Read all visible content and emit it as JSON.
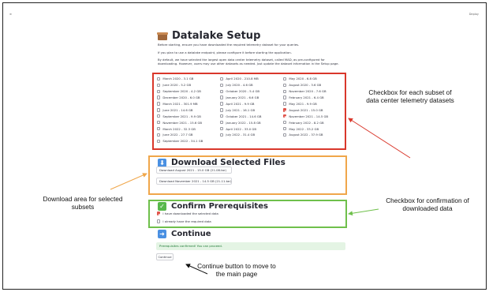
{
  "topbar": {
    "left": "≡",
    "right": "Deploy"
  },
  "header": {
    "title": "Datalake Setup",
    "icon": "package-icon"
  },
  "intro": {
    "line1": "Before starting, ensure you have downloaded the required telemetry dataset for your queries.",
    "line2": "If you plan to use a datalake endpoint, please configure it before starting the application.",
    "line3": "By default, we have selected the largest open data center telemetry dataset, called MAD, as pre-configured for downloading. However, users may use other datasets as needed. Just update the dataset information in the Setup page."
  },
  "datasets": [
    {
      "label": "March 2020 - 3.1 GB",
      "checked": false
    },
    {
      "label": "April 2020 - 210.8 MB",
      "checked": false
    },
    {
      "label": "May 2020 - 6.8 GB",
      "checked": false
    },
    {
      "label": "June 2020 - 5.2 GB",
      "checked": false
    },
    {
      "label": "July 2020 - 4.6 GB",
      "checked": false
    },
    {
      "label": "August 2020 - 3.6 GB",
      "checked": false
    },
    {
      "label": "September 2020 - 4.2 GB",
      "checked": false
    },
    {
      "label": "October 2020 - 5.4 GB",
      "checked": false
    },
    {
      "label": "November 2020 - 7.6 GB",
      "checked": false
    },
    {
      "label": "December 2020 - 6.0 GB",
      "checked": false
    },
    {
      "label": "January 2021 - 6.6 GB",
      "checked": false
    },
    {
      "label": "February 2021 - 6.4 GB",
      "checked": false
    },
    {
      "label": "March 2021 - 301.9 MB",
      "checked": false
    },
    {
      "label": "April 2021 - 9.9 GB",
      "checked": false
    },
    {
      "label": "May 2021 - 9.9 GB",
      "checked": false
    },
    {
      "label": "June 2021 - 14.6 GB",
      "checked": false
    },
    {
      "label": "July 2021 - 16.1 GB",
      "checked": false
    },
    {
      "label": "August 2021 - 15.0 GB",
      "checked": true
    },
    {
      "label": "September 2021 - 9.9 GB",
      "checked": false
    },
    {
      "label": "October 2021 - 14.6 GB",
      "checked": false
    },
    {
      "label": "November 2021 - 14.5 GB",
      "checked": true
    },
    {
      "label": "November 2021 - 15.6 GB",
      "checked": false
    },
    {
      "label": "January 2022 - 15.8 GB",
      "checked": false
    },
    {
      "label": "February 2022 - 8.2 GB",
      "checked": false
    },
    {
      "label": "March 2022 - 32.3 GB",
      "checked": false
    },
    {
      "label": "April 2022 - 33.0 GB",
      "checked": false
    },
    {
      "label": "May 2022 - 33.2 GB",
      "checked": false
    },
    {
      "label": "June 2022 - 27.7 GB",
      "checked": false
    },
    {
      "label": "July 2022 - 31.4 GB",
      "checked": false
    },
    {
      "label": "August 2022 - 37.9 GB",
      "checked": false
    },
    {
      "label": "September 2022 - 34.1 GB",
      "checked": false
    }
  ],
  "download": {
    "title": "Download Selected Files",
    "icon": "download-icon",
    "files": [
      "Download August 2021 - 15.0 GB (21-08.tar)",
      "Download November 2021 - 14.5 GB (21-11.tar)"
    ]
  },
  "prereq": {
    "title": "Confirm Prerequisites",
    "icon": "checkmark-icon",
    "items": [
      {
        "label": "I have downloaded the selected data",
        "checked": true
      },
      {
        "label": "I already have the required data",
        "checked": false
      }
    ]
  },
  "continue": {
    "title": "Continue",
    "icon": "arrow-right-icon",
    "success": "Prerequisites confirmed! You can proceed.",
    "button": "Continue"
  },
  "annotations": {
    "checkbox_subset": "Checkbox for each subset of data center telemetry datasets",
    "download_area": "Download area for selected subsets",
    "confirm_checkbox": "Checkbox for confirmation of downloaded data",
    "continue_button": "Continue button to move to the main page"
  },
  "colors": {
    "red_box": "#d9372b",
    "orange_box": "#f0a64a",
    "green_box": "#6fc04b",
    "checkbox_checked": "#e0544b"
  }
}
